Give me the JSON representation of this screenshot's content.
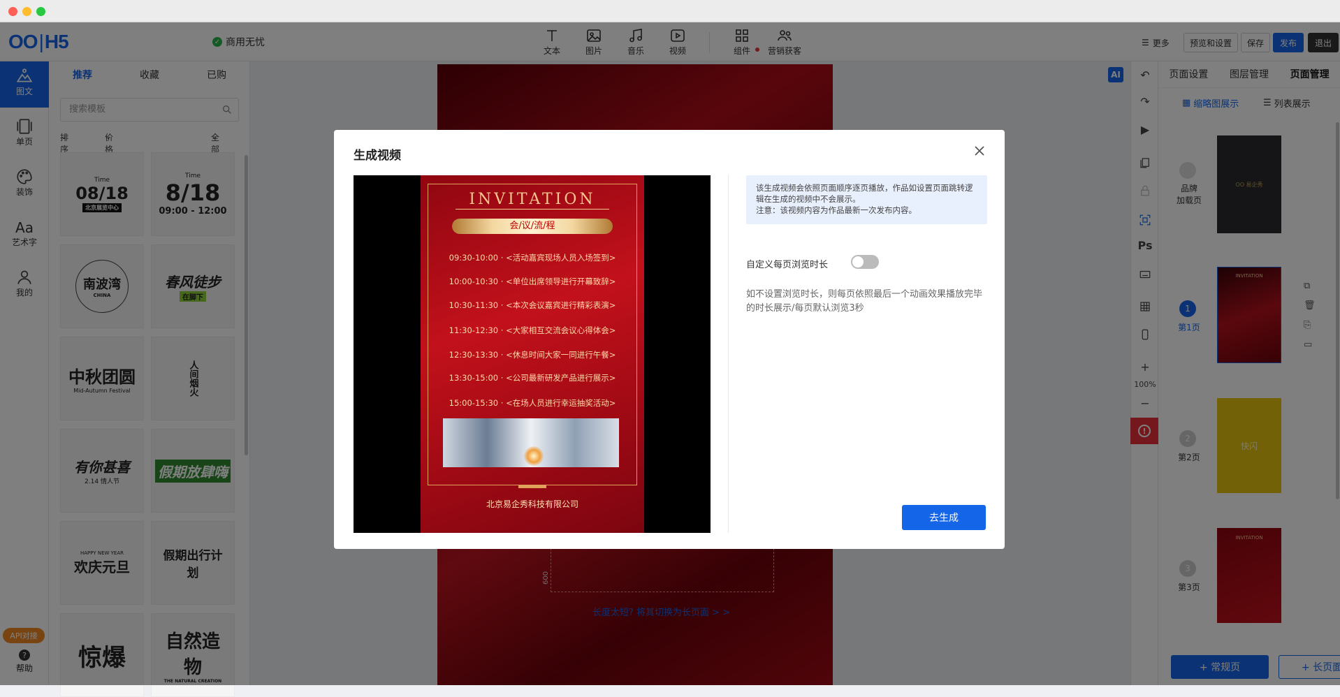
{
  "app": {
    "logo_main": "OO",
    "logo_sep": "|",
    "logo_sub": "H5",
    "business": "商用无忧"
  },
  "toolbar": {
    "text": "文本",
    "image": "图片",
    "music": "音乐",
    "video": "视频",
    "component": "组件",
    "marketing": "营销获客"
  },
  "topright": {
    "more": "更多",
    "preview": "预览和设置",
    "save": "保存",
    "publish": "发布",
    "exit": "退出"
  },
  "leftrail": {
    "items": [
      {
        "label": "图文"
      },
      {
        "label": "单页"
      },
      {
        "label": "装饰"
      },
      {
        "label": "艺术字"
      },
      {
        "label": "我的"
      }
    ],
    "api": "API对接",
    "help": "帮助"
  },
  "templates": {
    "tabs": [
      "推荐",
      "收藏",
      "已购"
    ],
    "search_placeholder": "搜索模板",
    "filters": {
      "sort": "排序",
      "price": "价格",
      "all": "全部"
    },
    "cards": [
      {
        "text": "08/18",
        "sub": "Time",
        "sub2": "北京展览中心"
      },
      {
        "text": "8/18",
        "sub": "Time",
        "sub2": "09:00 - 12:00"
      },
      {
        "text": "南波湾",
        "sub": "CHINA"
      },
      {
        "text": "春风徒步",
        "sub": "在脚下"
      },
      {
        "text": "中秋团圆",
        "sub": "Mid-Autumn Festival"
      },
      {
        "text": "人间烟火",
        "sub": ""
      },
      {
        "text": "有你甚喜",
        "sub": "2.14 情人节"
      },
      {
        "text": "假期放肆嗨",
        "sub": ""
      },
      {
        "text": "欢庆元旦",
        "sub": "HAPPY NEW YEAR"
      },
      {
        "text": "假期出行计划",
        "sub": ""
      },
      {
        "text": "惊爆",
        "sub": ""
      },
      {
        "text": "自然造物",
        "sub": "THE NATURAL CREATION"
      }
    ]
  },
  "canvas": {
    "ai": "AI",
    "ruler": "600",
    "long_tip": "长度太短? 将其切换为长页面 > >"
  },
  "righttools": {
    "ps": "Ps",
    "zoom": "100%",
    "plus": "+",
    "minus": "−"
  },
  "pages": {
    "tabs": [
      "页面设置",
      "图层管理",
      "页面管理"
    ],
    "view_thumb": "缩略图展示",
    "view_list": "列表展示",
    "items": [
      {
        "num": "",
        "label": "品牌\n加载页",
        "thumb_text": "OO 易企秀"
      },
      {
        "num": "1",
        "label": "第1页",
        "thumb_text": "INVITATION"
      },
      {
        "num": "2",
        "label": "第2页",
        "thumb_text": "快闪"
      },
      {
        "num": "3",
        "label": "第3页",
        "thumb_text": "INVITATION"
      }
    ],
    "add_normal": "+ 常规页",
    "add_long": "+ 长页面"
  },
  "modal": {
    "title": "生成视频",
    "info": "该生成视频会依照页面顺序逐页播放，作品如设置页面跳转逻辑在生成的视频中不会展示。\n注意：该视频内容为作品最新一次发布内容。",
    "toggle_label": "自定义每页浏览时长",
    "desc": "如不设置浏览时长，则每页依照最后一个动画效果播放完毕的时长展示/每页默认浏览3秒",
    "button": "去生成"
  },
  "invitation": {
    "title": "INVITATION",
    "pill": "会/议/流/程",
    "schedule": [
      {
        "time": "09:30-10:00",
        "item": "<活动嘉宾现场人员入场签到>"
      },
      {
        "time": "10:00-10:30",
        "item": "<单位出席领导进行开幕致辞>"
      },
      {
        "time": "10:30-11:30",
        "item": "<本次会议嘉宾进行精彩表演>"
      },
      {
        "time": "11:30-12:30",
        "item": "<大家相互交流会议心得体会>"
      },
      {
        "time": "12:30-13:30",
        "item": "<休息时间大家一同进行午餐>"
      },
      {
        "time": "13:30-15:00",
        "item": "<公司最新研发产品进行展示>"
      },
      {
        "time": "15:00-15:30",
        "item": "<在场人员进行幸运抽奖活动>"
      }
    ],
    "company": "北京易企秀科技有限公司"
  },
  "colors": {
    "accent": "#1565e8",
    "invite_red": "#c2111c",
    "gold": "#f4c890"
  }
}
